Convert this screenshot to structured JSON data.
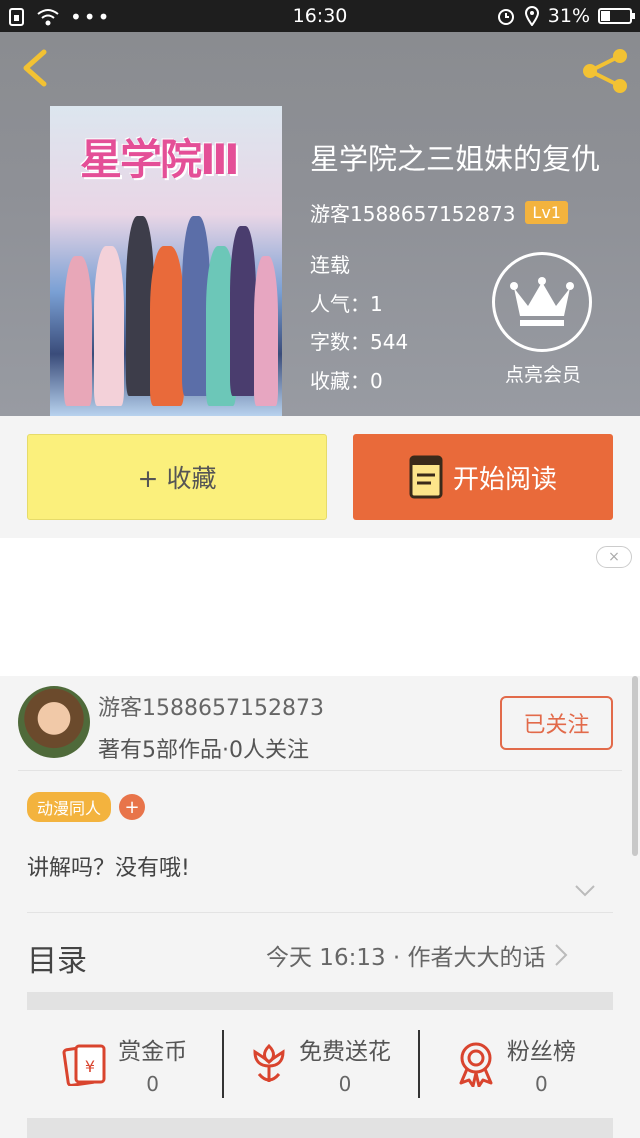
{
  "status_bar": {
    "time": "16:30",
    "battery": "31%",
    "battery_level": 0.31
  },
  "book": {
    "cover_text": "星学院Ⅲ",
    "title": "星学院之三姐妹的复仇",
    "author": "游客1588657152873",
    "level": "Lv1",
    "stats": [
      "连载",
      "人气：1",
      "字数：544",
      "收藏：0"
    ],
    "vip_label": "点亮会员"
  },
  "buttons": {
    "favorite": "+ 收藏",
    "read": "开始阅读"
  },
  "ad": {
    "close": "×"
  },
  "author_card": {
    "name": "游客1588657152873",
    "works": "著有5部作品·0人关注",
    "follow": "已关注",
    "tag": "动漫同人",
    "tag_add": "+",
    "intro": "讲解吗？没有哦!"
  },
  "toc": {
    "label": "目录",
    "latest": "今天 16:13 · 作者大大的话"
  },
  "actions": [
    {
      "label": "赏金币",
      "count": "0",
      "icon": "red-envelope-icon"
    },
    {
      "label": "免费送花",
      "count": "0",
      "icon": "flower-icon"
    },
    {
      "label": "粉丝榜",
      "count": "0",
      "icon": "medal-icon"
    }
  ],
  "colors": {
    "accent": "#e96a3a",
    "favorite": "#fbf07c",
    "badge": "#f3b33e",
    "icon_red": "#d9442e"
  }
}
